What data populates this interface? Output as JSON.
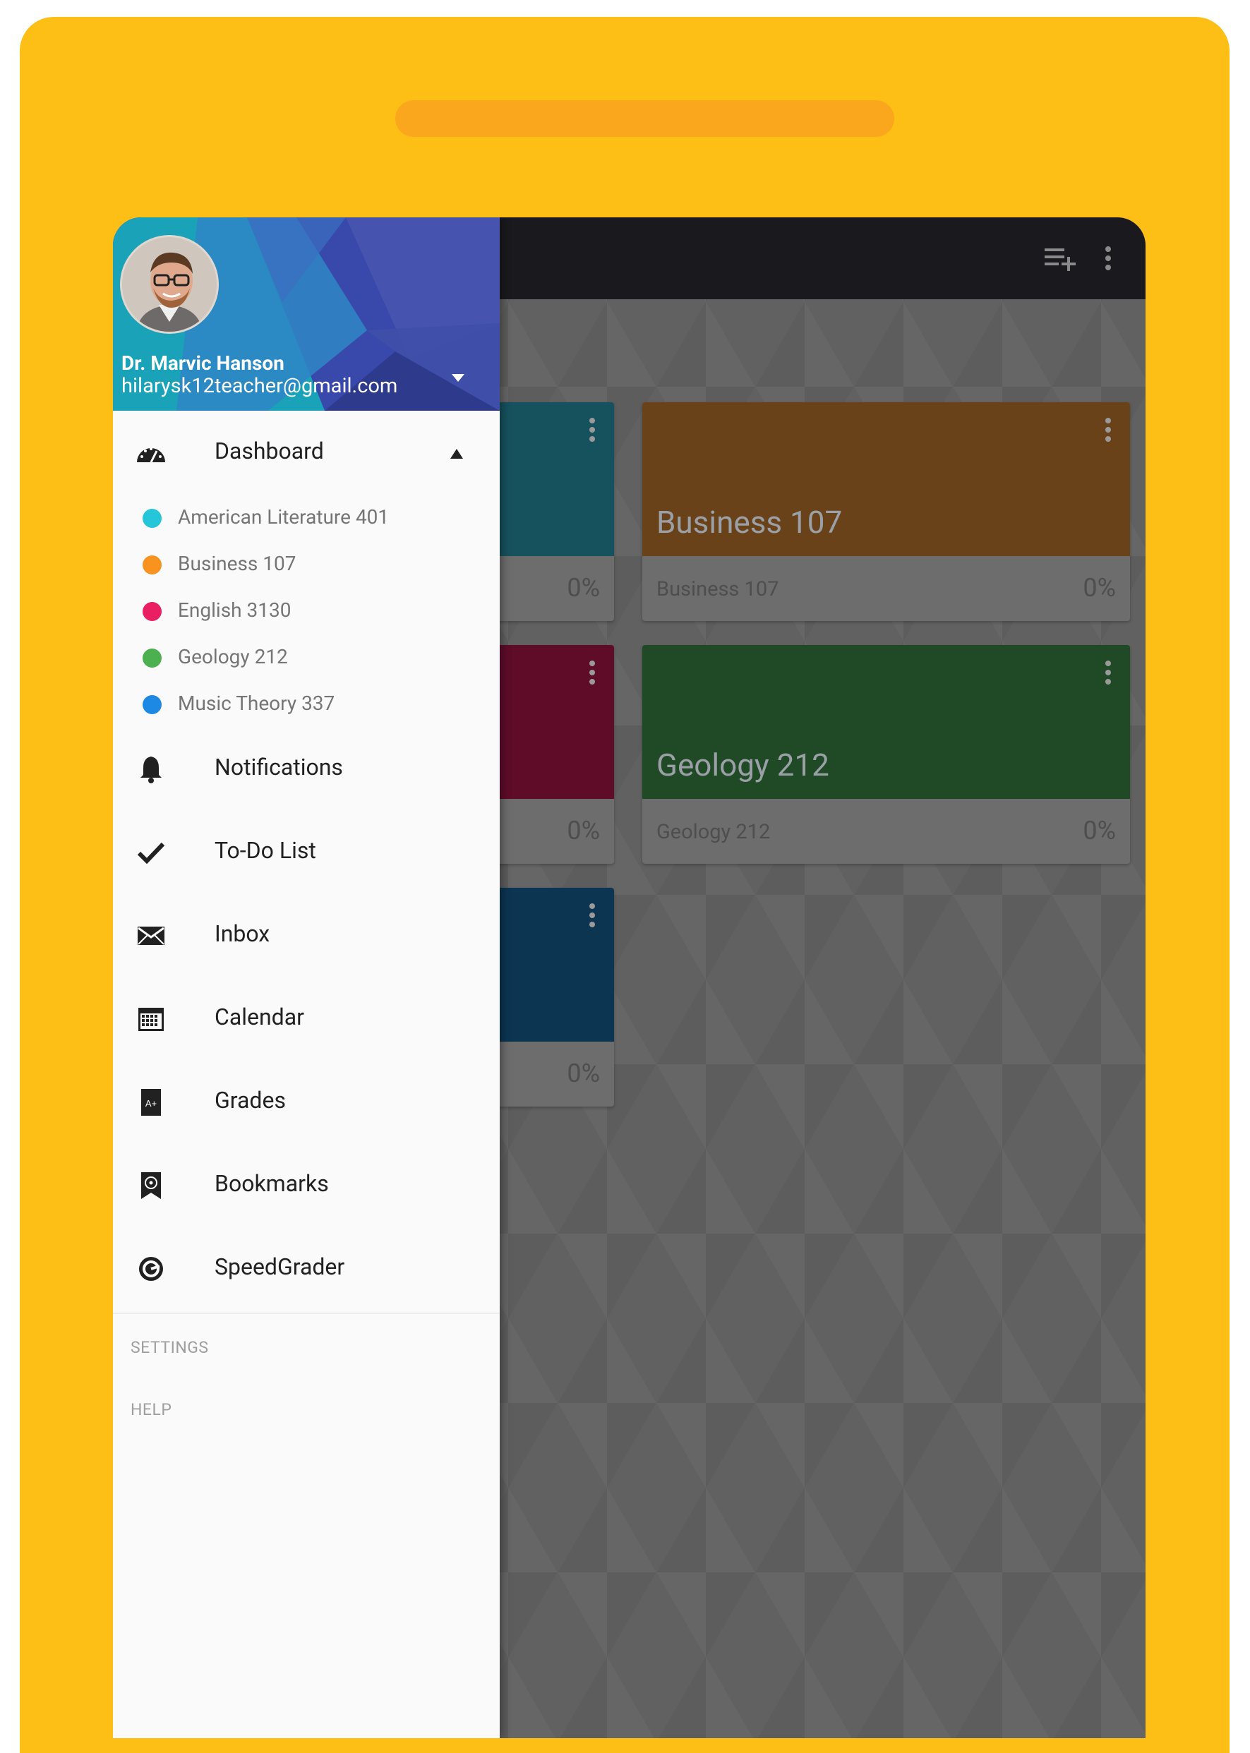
{
  "drawer": {
    "user_name": "Dr. Marvic Hanson",
    "user_email": "hilarysk12teacher@gmail.com",
    "dashboard_label": "Dashboard",
    "courses": [
      {
        "label": "American Literature 401",
        "color": "#26c6da"
      },
      {
        "label": "Business 107",
        "color": "#f7931e"
      },
      {
        "label": "English 3130",
        "color": "#e91e63"
      },
      {
        "label": "Geology 212",
        "color": "#4caf50"
      },
      {
        "label": "Music Theory 337",
        "color": "#1e88e5"
      }
    ],
    "nav": [
      {
        "label": "Notifications",
        "icon": "bell-icon"
      },
      {
        "label": "To-Do List",
        "icon": "check-icon"
      },
      {
        "label": "Inbox",
        "icon": "envelope-icon"
      },
      {
        "label": "Calendar",
        "icon": "calendar-icon"
      },
      {
        "label": "Grades",
        "icon": "grades-icon"
      },
      {
        "label": "Bookmarks",
        "icon": "bookmark-icon"
      },
      {
        "label": "SpeedGrader",
        "icon": "speedgrader-icon"
      }
    ],
    "settings_label": "SETTINGS",
    "help_label": "HELP"
  },
  "cards": [
    {
      "title": "",
      "footer_name": "",
      "percent": "0%",
      "color": "#16525e"
    },
    {
      "title": "Business 107",
      "footer_name": "Business 107",
      "percent": "0%",
      "color": "#6a421a"
    },
    {
      "title": "",
      "footer_name": "",
      "percent": "0%",
      "color": "#5e0c28"
    },
    {
      "title": "Geology 212",
      "footer_name": "Geology 212",
      "percent": "0%",
      "color": "#1f4a25"
    },
    {
      "title": "",
      "footer_name": "",
      "percent": "0%",
      "color": "#0c3552"
    }
  ],
  "colors": {
    "device": "#FDBE15",
    "speaker": "#FBA71E",
    "topbar": "#1a1a1e",
    "header": "#3f51b5"
  }
}
